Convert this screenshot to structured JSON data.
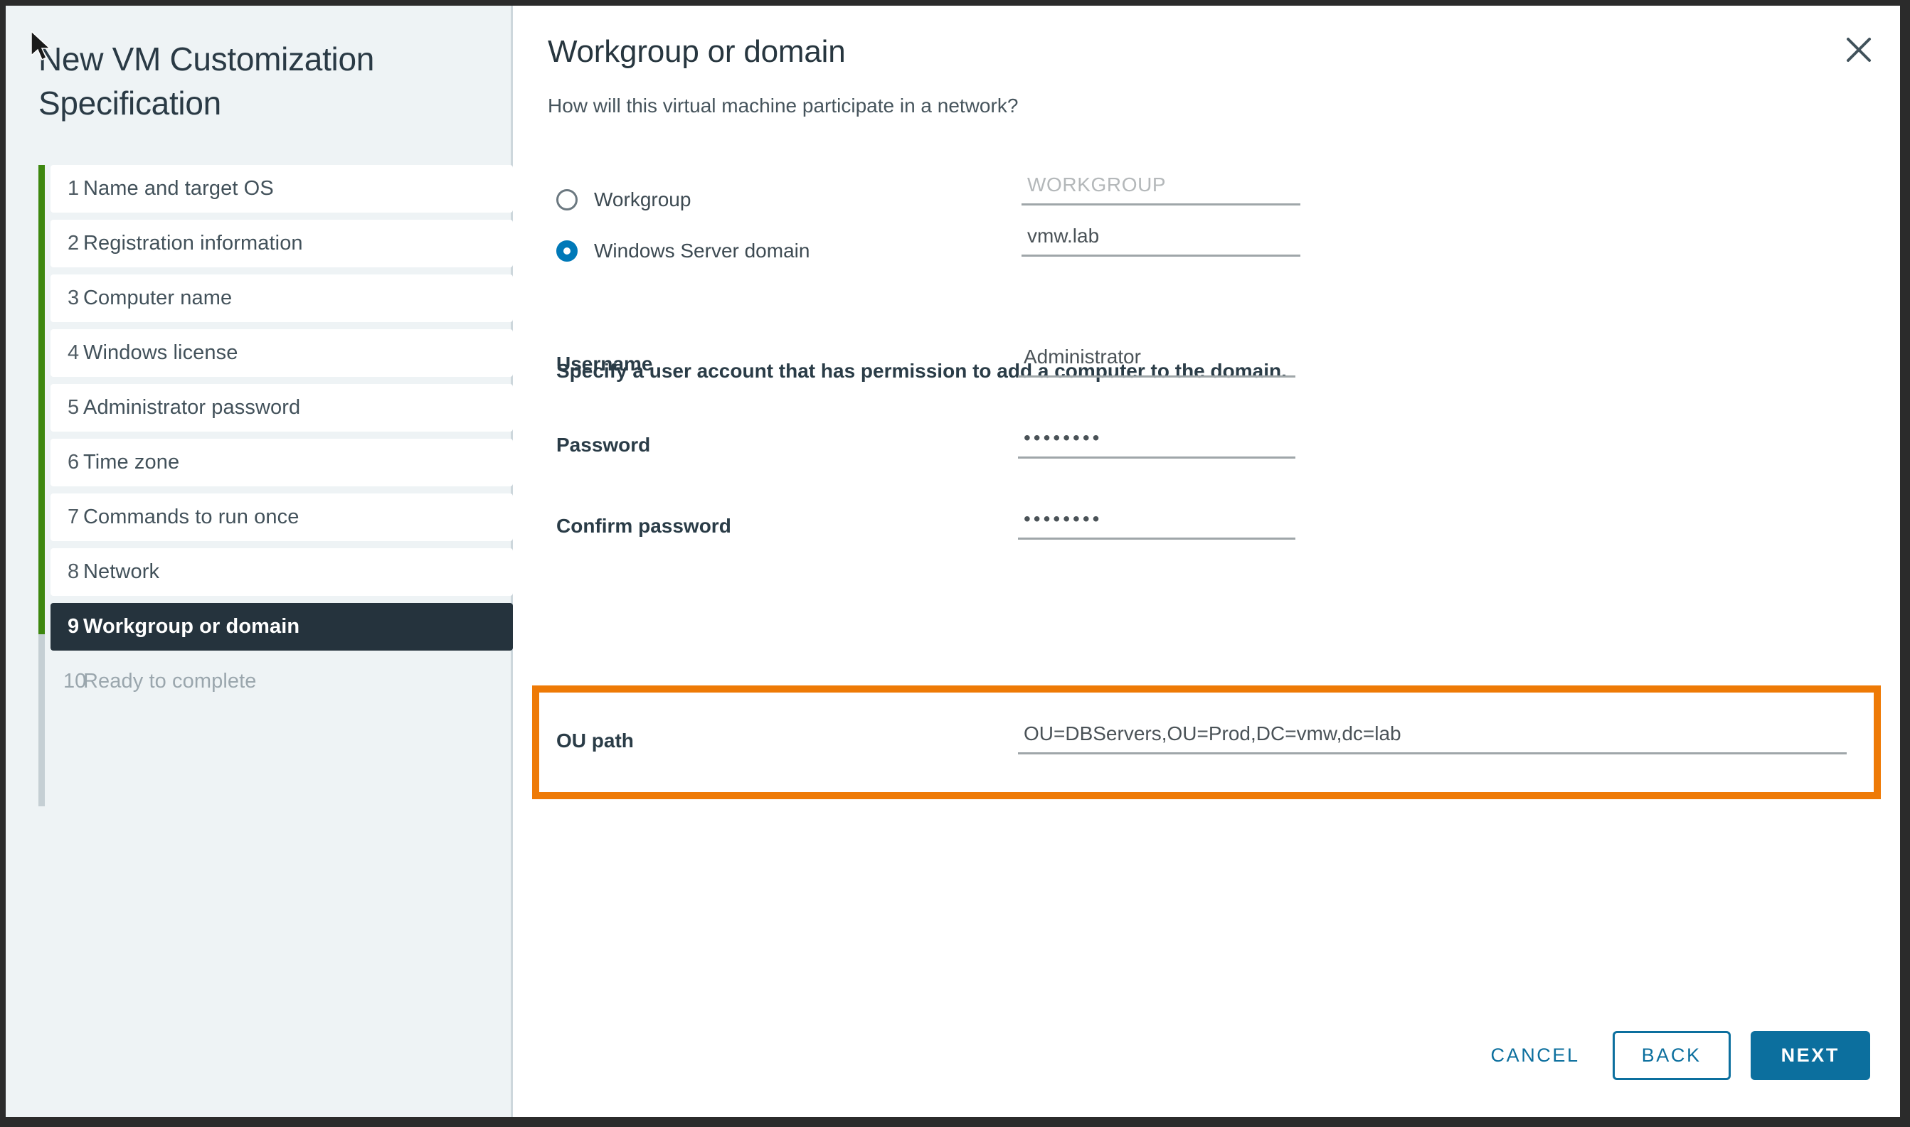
{
  "wizard": {
    "title": "New VM Customization Specification",
    "close_icon": "close-icon"
  },
  "sidebar": {
    "steps": [
      {
        "num": "1",
        "label": "Name and target OS",
        "state": "done"
      },
      {
        "num": "2",
        "label": "Registration information",
        "state": "done"
      },
      {
        "num": "3",
        "label": "Computer name",
        "state": "done"
      },
      {
        "num": "4",
        "label": "Windows license",
        "state": "done"
      },
      {
        "num": "5",
        "label": "Administrator password",
        "state": "done"
      },
      {
        "num": "6",
        "label": "Time zone",
        "state": "done"
      },
      {
        "num": "7",
        "label": "Commands to run once",
        "state": "done"
      },
      {
        "num": "8",
        "label": "Network",
        "state": "done"
      },
      {
        "num": "9",
        "label": "Workgroup or domain",
        "state": "selected"
      },
      {
        "num": "10",
        "label": "Ready to complete",
        "state": "disabled"
      }
    ],
    "progress_color": "#3d870f",
    "rail_color": "#c5cfd4",
    "selected_color": "#25333d"
  },
  "main": {
    "page_title": "Workgroup or domain",
    "page_subtitle": "How will this virtual machine participate in a network?",
    "options": {
      "workgroup": {
        "label": "Workgroup",
        "selected": false,
        "value": "",
        "placeholder": "WORKGROUP"
      },
      "domain": {
        "label": "Windows Server domain",
        "selected": true,
        "value": "vmw.lab",
        "placeholder": ""
      }
    },
    "accent_color": "#0079b8",
    "hint": "Specify a user account that has permission to add a computer to the domain.",
    "fields": [
      {
        "label": "Username",
        "value": "Administrator",
        "type": "text"
      },
      {
        "label": "Password",
        "value": "••••••••",
        "type": "password"
      },
      {
        "label": "Confirm password",
        "value": "••••••••",
        "type": "password"
      }
    ],
    "ou_path": {
      "label": "OU path",
      "value": "OU=DBServers,OU=Prod,DC=vmw,dc=lab",
      "highlight_color": "#ee7a06"
    }
  },
  "footer": {
    "cancel_label": "CANCEL",
    "back_label": "BACK",
    "next_label": "NEXT",
    "primary_color": "#0c6f9e"
  }
}
